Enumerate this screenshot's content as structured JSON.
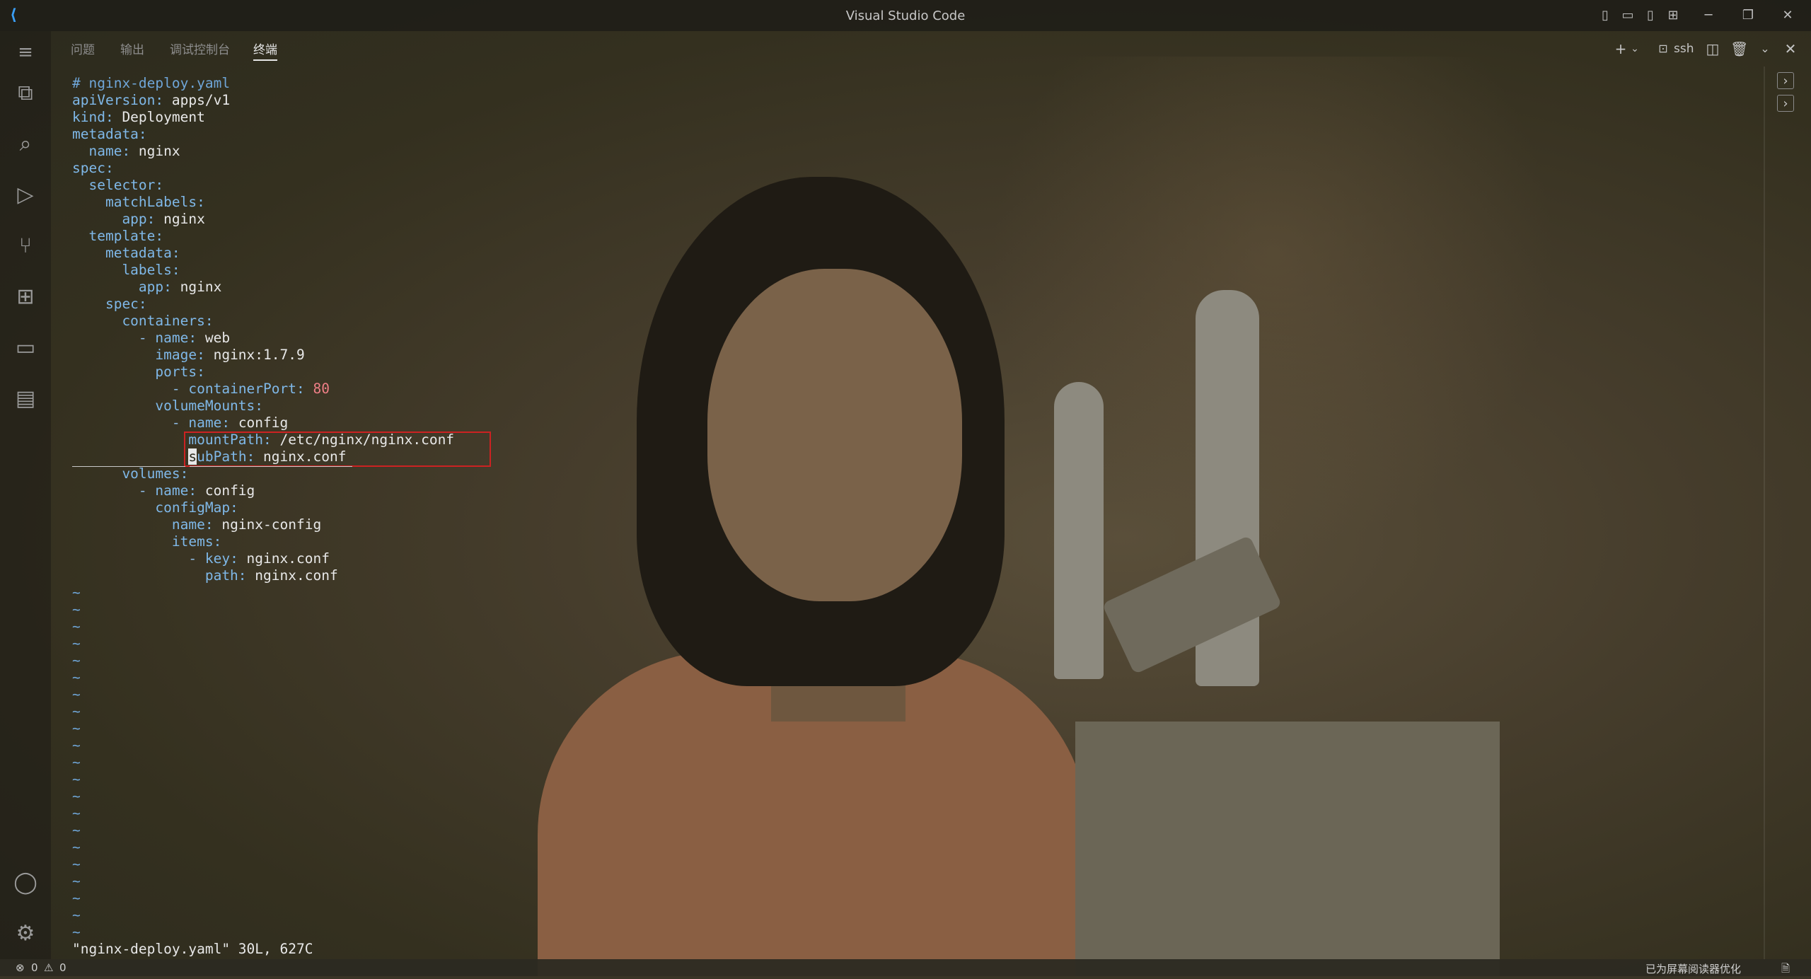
{
  "window": {
    "title": "Visual Studio Code"
  },
  "panel": {
    "tabs": [
      {
        "label": "问题"
      },
      {
        "label": "输出"
      },
      {
        "label": "调试控制台"
      },
      {
        "label": "终端",
        "active": true
      }
    ],
    "terminal_profile": "ssh"
  },
  "terminal": {
    "lines": [
      {
        "segments": [
          {
            "t": "# nginx-deploy.yaml",
            "c": "c"
          }
        ]
      },
      {
        "segments": [
          {
            "t": "apiVersion:",
            "c": "k"
          },
          {
            "t": " apps/v1",
            "c": "v"
          }
        ]
      },
      {
        "segments": [
          {
            "t": "kind:",
            "c": "k"
          },
          {
            "t": " Deployment",
            "c": "v"
          }
        ]
      },
      {
        "segments": [
          {
            "t": "metadata:",
            "c": "k"
          }
        ]
      },
      {
        "segments": [
          {
            "t": "  name:",
            "c": "k"
          },
          {
            "t": " nginx",
            "c": "v"
          }
        ]
      },
      {
        "segments": [
          {
            "t": "spec:",
            "c": "k"
          }
        ]
      },
      {
        "segments": [
          {
            "t": "  selector:",
            "c": "k"
          }
        ]
      },
      {
        "segments": [
          {
            "t": "    matchLabels:",
            "c": "k"
          }
        ]
      },
      {
        "segments": [
          {
            "t": "      app:",
            "c": "k"
          },
          {
            "t": " nginx",
            "c": "v"
          }
        ]
      },
      {
        "segments": [
          {
            "t": "  template:",
            "c": "k"
          }
        ]
      },
      {
        "segments": [
          {
            "t": "    metadata:",
            "c": "k"
          }
        ]
      },
      {
        "segments": [
          {
            "t": "      labels:",
            "c": "k"
          }
        ]
      },
      {
        "segments": [
          {
            "t": "        app:",
            "c": "k"
          },
          {
            "t": " nginx",
            "c": "v"
          }
        ]
      },
      {
        "segments": [
          {
            "t": "    spec:",
            "c": "k"
          }
        ]
      },
      {
        "segments": [
          {
            "t": "      containers:",
            "c": "k"
          }
        ]
      },
      {
        "segments": [
          {
            "t": "        - ",
            "c": "d"
          },
          {
            "t": "name:",
            "c": "k"
          },
          {
            "t": " web",
            "c": "v"
          }
        ]
      },
      {
        "segments": [
          {
            "t": "          image:",
            "c": "k"
          },
          {
            "t": " nginx:1.7.9",
            "c": "v"
          }
        ]
      },
      {
        "segments": [
          {
            "t": "          ports:",
            "c": "k"
          }
        ]
      },
      {
        "segments": [
          {
            "t": "            - ",
            "c": "d"
          },
          {
            "t": "containerPort:",
            "c": "k"
          },
          {
            "t": " 80",
            "c": "n"
          }
        ]
      },
      {
        "segments": [
          {
            "t": "          volumeMounts:",
            "c": "k"
          }
        ]
      },
      {
        "segments": [
          {
            "t": "            - ",
            "c": "d"
          },
          {
            "t": "name:",
            "c": "k"
          },
          {
            "t": " config",
            "c": "v"
          }
        ]
      },
      {
        "segments": [
          {
            "t": "              mountPath:",
            "c": "k"
          },
          {
            "t": " /etc/nginx/nginx.conf",
            "c": "v"
          }
        ]
      },
      {
        "segments": [
          {
            "t": "              ",
            "c": "k"
          },
          {
            "t": "s",
            "c": "cursor"
          },
          {
            "t": "ubPath:",
            "c": "k"
          },
          {
            "t": " nginx.conf",
            "c": "v"
          }
        ]
      },
      {
        "segments": [
          {
            "t": "      volumes:",
            "c": "k"
          }
        ]
      },
      {
        "segments": [
          {
            "t": "        - ",
            "c": "d"
          },
          {
            "t": "name:",
            "c": "k"
          },
          {
            "t": " config",
            "c": "v"
          }
        ]
      },
      {
        "segments": [
          {
            "t": "          configMap:",
            "c": "k"
          }
        ]
      },
      {
        "segments": [
          {
            "t": "            name:",
            "c": "k"
          },
          {
            "t": " nginx-config",
            "c": "v"
          }
        ]
      },
      {
        "segments": [
          {
            "t": "            items:",
            "c": "k"
          }
        ]
      },
      {
        "segments": [
          {
            "t": "              - ",
            "c": "d"
          },
          {
            "t": "key:",
            "c": "k"
          },
          {
            "t": " nginx.conf",
            "c": "v"
          }
        ]
      },
      {
        "segments": [
          {
            "t": "                path:",
            "c": "k"
          },
          {
            "t": " nginx.conf",
            "c": "v"
          }
        ]
      }
    ],
    "tilde_count": 21,
    "tilde_char": "~",
    "file_status": "\"nginx-deploy.yaml\" 30L, 627C"
  },
  "statusbar": {
    "errors": "0",
    "warnings": "0",
    "right_text": "已为屏幕阅读器优化"
  },
  "colors": {
    "accent": "#3a9ef5",
    "highlight_box": "#cc2222"
  }
}
